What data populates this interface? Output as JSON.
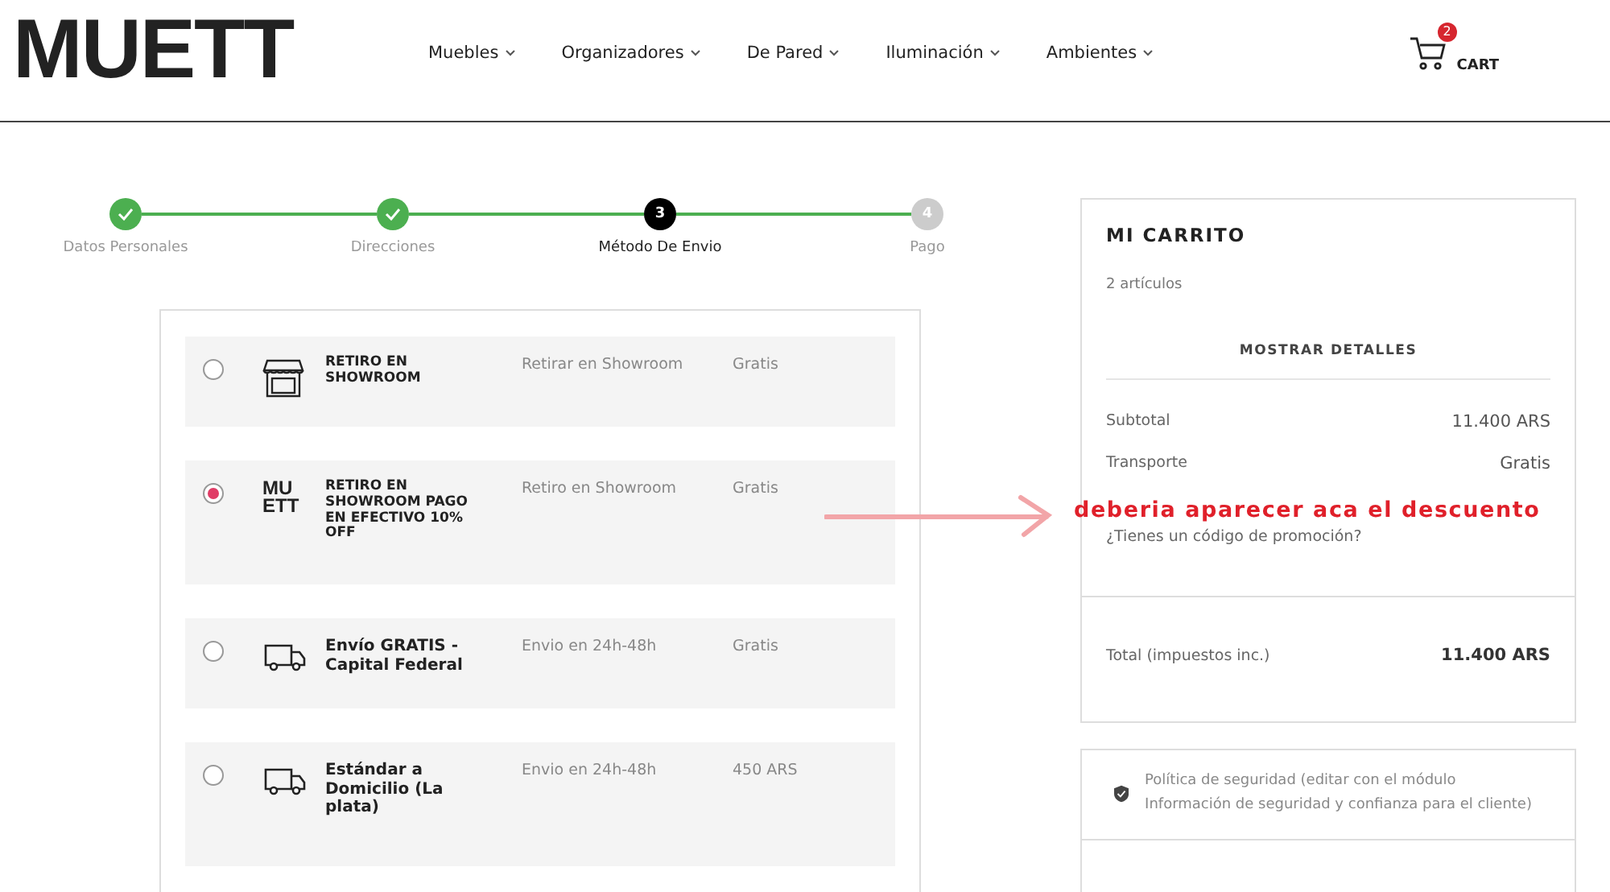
{
  "header": {
    "logo": "MUETT",
    "nav": [
      {
        "label": "Muebles"
      },
      {
        "label": "Organizadores"
      },
      {
        "label": "De Pared"
      },
      {
        "label": "Iluminación"
      },
      {
        "label": "Ambientes"
      }
    ],
    "cart": {
      "count": "2",
      "label": "CART"
    }
  },
  "steps": [
    {
      "label": "Datos Personales",
      "completed": true,
      "selected": false
    },
    {
      "label": "Direcciones",
      "completed": true,
      "selected": false
    },
    {
      "number": "3",
      "label": "Método De Envio",
      "completed": false,
      "selected": true
    },
    {
      "number": "4",
      "label": "Pago",
      "completed": false,
      "selected": false
    }
  ],
  "shipping_options": [
    {
      "kind": "store",
      "title": "RETIRO EN SHOWROOM",
      "description": "Retirar en Showroom",
      "price": "Gratis",
      "selected": false
    },
    {
      "kind": "logo",
      "icon_text": [
        "MU",
        "ETT"
      ],
      "title": "RETIRO EN SHOWROOM PAGO EN EFECTIVO 10% OFF",
      "description": "Retiro en Showroom",
      "price": "Gratis",
      "selected": true
    },
    {
      "kind": "truck",
      "title": "Envío GRATIS - Capital Federal",
      "description": "Envio en 24h-48h",
      "price": "Gratis",
      "selected": false
    },
    {
      "kind": "truck",
      "title": "Estándar a Domicilio (La plata)",
      "description": "Envio en 24h-48h",
      "price": "450 ARS",
      "selected": false
    }
  ],
  "cart_summary": {
    "title": "MI CARRITO",
    "item_count": "2 artículos",
    "details_button": "MOSTRAR DETALLES",
    "lines": [
      {
        "label": "Subtotal",
        "value": "11.400 ARS"
      },
      {
        "label": "Transporte",
        "value": "Gratis"
      }
    ],
    "promo_link": "¿Tienes un código de promoción?",
    "total_label": "Total (impuestos inc.)",
    "total_value": "11.400 ARS"
  },
  "annotation": {
    "text": "deberia aparecer aca el descuento"
  },
  "trust": {
    "text": "Política de seguridad (editar con el módulo Información de seguridad y confianza para el cliente)"
  }
}
